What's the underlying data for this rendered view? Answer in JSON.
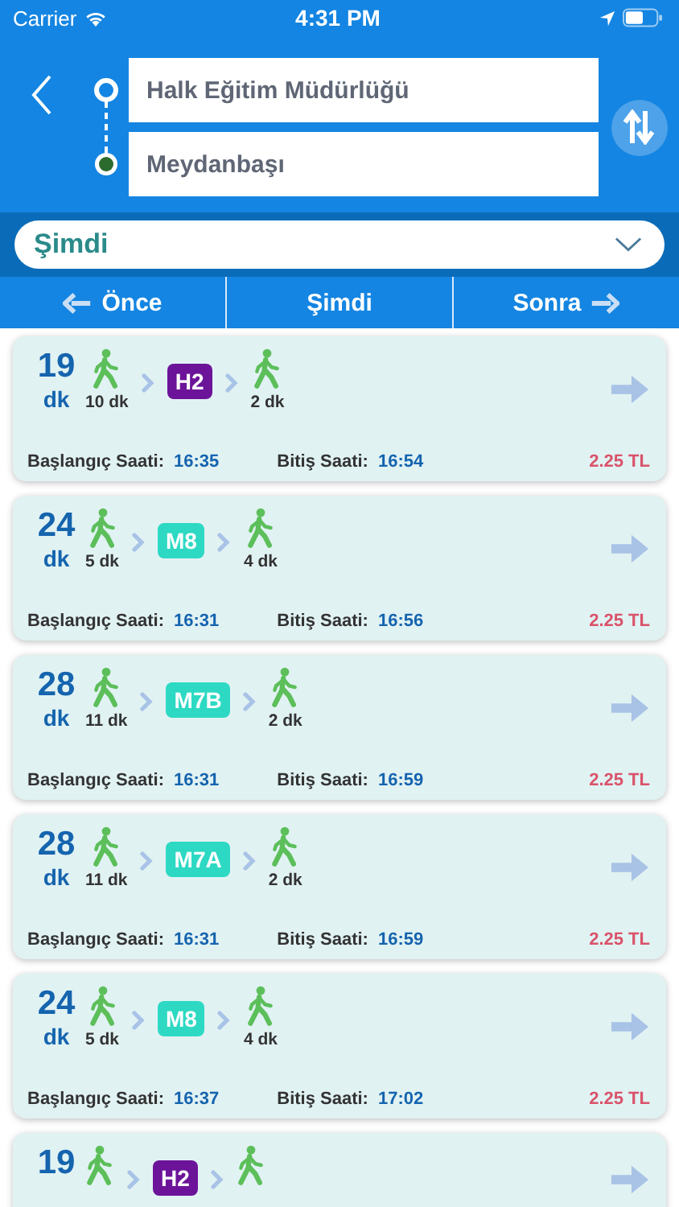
{
  "status_bar": {
    "carrier": "Carrier",
    "time": "4:31 PM"
  },
  "route": {
    "origin": "Halk Eğitim Müdürlüğü",
    "destination": "Meydanbaşı"
  },
  "time_select": {
    "value": "Şimdi"
  },
  "nav": [
    {
      "label": "Önce",
      "kind": "back"
    },
    {
      "label": "Şimdi",
      "kind": "plain"
    },
    {
      "label": "Sonra",
      "kind": "forward"
    }
  ],
  "trips": [
    {
      "minutes": "19",
      "unit": "dk",
      "legs": [
        {
          "kind": "walk",
          "duration": "10 dk"
        },
        {
          "kind": "line",
          "label": "H2",
          "color": "#6c1499"
        },
        {
          "kind": "walk",
          "duration": "2 dk"
        }
      ],
      "start_label": "Başlangıç Saati:",
      "start": "16:35",
      "end_label": "Bitiş Saati:",
      "end": "16:54",
      "price": "2.25 TL"
    },
    {
      "minutes": "24",
      "unit": "dk",
      "legs": [
        {
          "kind": "walk",
          "duration": "5 dk"
        },
        {
          "kind": "line",
          "label": "M8",
          "color": "#2dd9c3"
        },
        {
          "kind": "walk",
          "duration": "4 dk"
        }
      ],
      "start_label": "Başlangıç Saati:",
      "start": "16:31",
      "end_label": "Bitiş Saati:",
      "end": "16:56",
      "price": "2.25 TL"
    },
    {
      "minutes": "28",
      "unit": "dk",
      "legs": [
        {
          "kind": "walk",
          "duration": "11 dk"
        },
        {
          "kind": "line",
          "label": "M7B",
          "color": "#2dd9c3"
        },
        {
          "kind": "walk",
          "duration": "2 dk"
        }
      ],
      "start_label": "Başlangıç Saati:",
      "start": "16:31",
      "end_label": "Bitiş Saati:",
      "end": "16:59",
      "price": "2.25 TL"
    },
    {
      "minutes": "28",
      "unit": "dk",
      "legs": [
        {
          "kind": "walk",
          "duration": "11 dk"
        },
        {
          "kind": "line",
          "label": "M7A",
          "color": "#2dd9c3"
        },
        {
          "kind": "walk",
          "duration": "2 dk"
        }
      ],
      "start_label": "Başlangıç Saati:",
      "start": "16:31",
      "end_label": "Bitiş Saati:",
      "end": "16:59",
      "price": "2.25 TL"
    },
    {
      "minutes": "24",
      "unit": "dk",
      "legs": [
        {
          "kind": "walk",
          "duration": "5 dk"
        },
        {
          "kind": "line",
          "label": "M8",
          "color": "#2dd9c3"
        },
        {
          "kind": "walk",
          "duration": "4 dk"
        }
      ],
      "start_label": "Başlangıç Saati:",
      "start": "16:37",
      "end_label": "Bitiş Saati:",
      "end": "17:02",
      "price": "2.25 TL"
    },
    {
      "minutes": "19",
      "legs": [
        {
          "kind": "walk"
        },
        {
          "kind": "line",
          "label": "H2",
          "color": "#6c1499"
        },
        {
          "kind": "walk"
        }
      ]
    }
  ]
}
